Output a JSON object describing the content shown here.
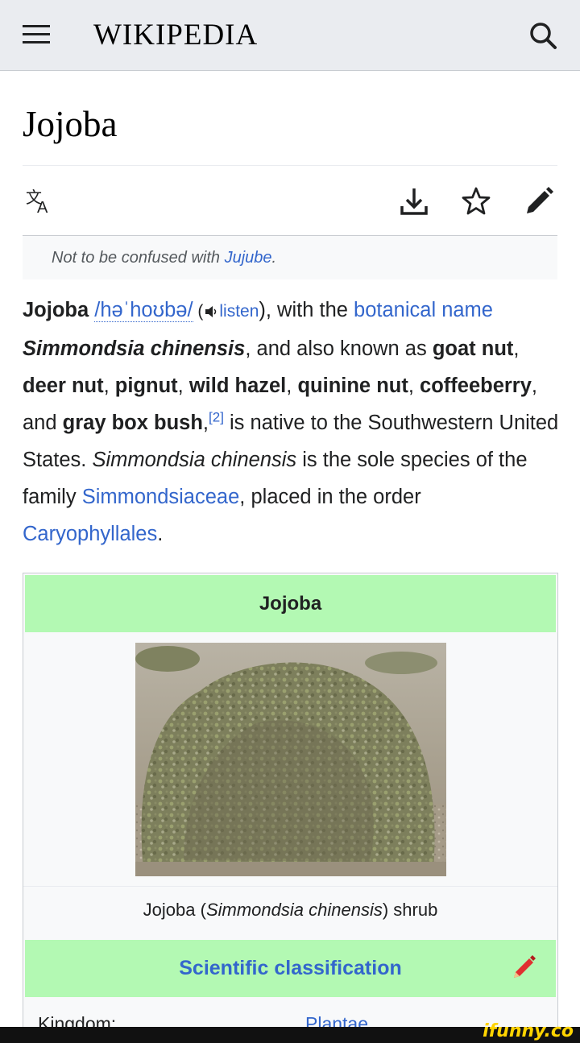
{
  "header": {
    "wordmark": "WIKIPEDIA",
    "menu_icon": "hamburger-menu-icon",
    "search_icon": "search-icon"
  },
  "page": {
    "title": "Jojoba",
    "toolbar": {
      "language_icon": "language-icon",
      "download_icon": "download-icon",
      "watch_icon": "star-icon",
      "edit_icon": "pencil-icon"
    },
    "hatnote": {
      "prefix": "Not to be confused with ",
      "link": "Jujube",
      "suffix": "."
    },
    "lead": {
      "s1": "Jojoba",
      "ipa": "/həˈhoʊbə/",
      "open_paren": " (",
      "listen": "listen",
      "close_with": "), with the ",
      "botanical_name_link": "botanical name",
      "sci_name": "Simmondsia chinensis",
      "t1": ", and also known as ",
      "n1": "goat nut",
      "c1": ", ",
      "n2": "deer nut",
      "c2": ", ",
      "n3": "pignut",
      "c3": ", ",
      "n4": "wild hazel",
      "c4": ", ",
      "n5": "quinine nut",
      "c5": ", ",
      "n6": "coffeeberry",
      "c6": ", and ",
      "n7": "gray box bush",
      "c7": ",",
      "ref": "[2]",
      "t2": " is native to the Southwestern United States. ",
      "sci_name2": "Simmondsia chinensis",
      "t3": " is the sole species of the family ",
      "family_link": "Simmondsiaceae",
      "t4": ", placed in the order ",
      "order_link": "Caryophyllales",
      "t5": "."
    }
  },
  "infobox": {
    "title": "Jojoba",
    "caption_pre": "Jojoba (",
    "caption_sci": "Simmondsia chinensis",
    "caption_post": ") shrub",
    "sci_header": "Scientific classification",
    "row_label": "Kingdom:",
    "row_value": "Plantae"
  },
  "watermark": "ifunny.co",
  "colors": {
    "link": "#3366cc",
    "infobox_header": "#b3f9b3",
    "header_bg": "#eaecf0"
  }
}
